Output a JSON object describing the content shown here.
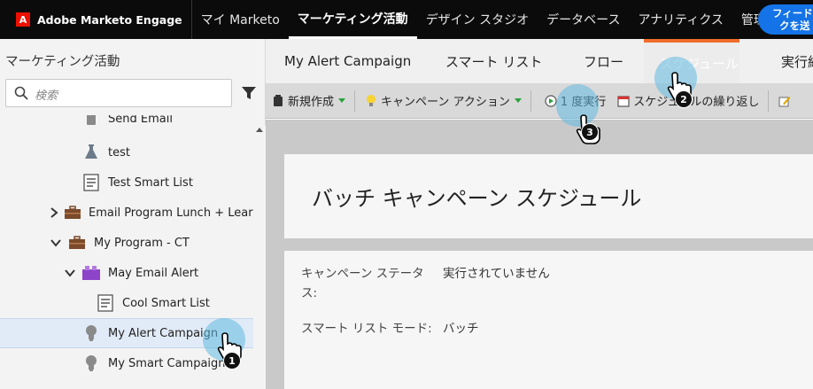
{
  "topnav": {
    "brand": "Adobe Marketo Engage",
    "items": [
      "マイ Marketo",
      "マーケティング活動",
      "デザイン スタジオ",
      "データベース",
      "アナリティクス",
      "管理"
    ],
    "feedback_line1": "フィード",
    "feedback_line2": "クを送"
  },
  "sidebar": {
    "title": "マーケティング活動",
    "search_placeholder": "検索",
    "tree": [
      {
        "label": "Send Email",
        "icon": "email-program-icon"
      },
      {
        "label": "test",
        "icon": "flask-icon"
      },
      {
        "label": "Test Smart List",
        "icon": "smart-list-icon"
      },
      {
        "label": "Email Program Lunch + Learn",
        "icon": "program-briefcase-icon"
      },
      {
        "label": "My Program - CT",
        "icon": "program-briefcase-icon"
      },
      {
        "label": "May Email Alert",
        "icon": "email-program-icon"
      },
      {
        "label": "Cool Smart List",
        "icon": "smart-list-icon"
      },
      {
        "label": "My Alert Campaign",
        "icon": "campaign-bulb-icon"
      },
      {
        "label": "My Smart Campaign",
        "icon": "campaign-bulb-icon"
      }
    ]
  },
  "tabs": [
    "My Alert Campaign",
    "スマート リスト",
    "フロー",
    "スケジュール",
    "実行結"
  ],
  "toolbar": {
    "new": "新規作成",
    "campaign_actions": "キャンペーン アクション",
    "run_once": "1 度実行",
    "recurrence": "スケジュールの繰り返し"
  },
  "main": {
    "title": "バッチ キャンペーン スケジュール",
    "status_label": "キャンペーン ステータス:",
    "status_value": "実行されていません",
    "mode_label": "スマート リスト モード:",
    "mode_value": "バッチ"
  },
  "steps": [
    "1",
    "2",
    "3"
  ],
  "colors": {
    "topnav_bg": "#0b0b0b",
    "accent_tab": "#f06c2a",
    "feedback_btn": "#1473e6",
    "selected_row": "#e1ebf7",
    "marker": "#60bae0"
  }
}
